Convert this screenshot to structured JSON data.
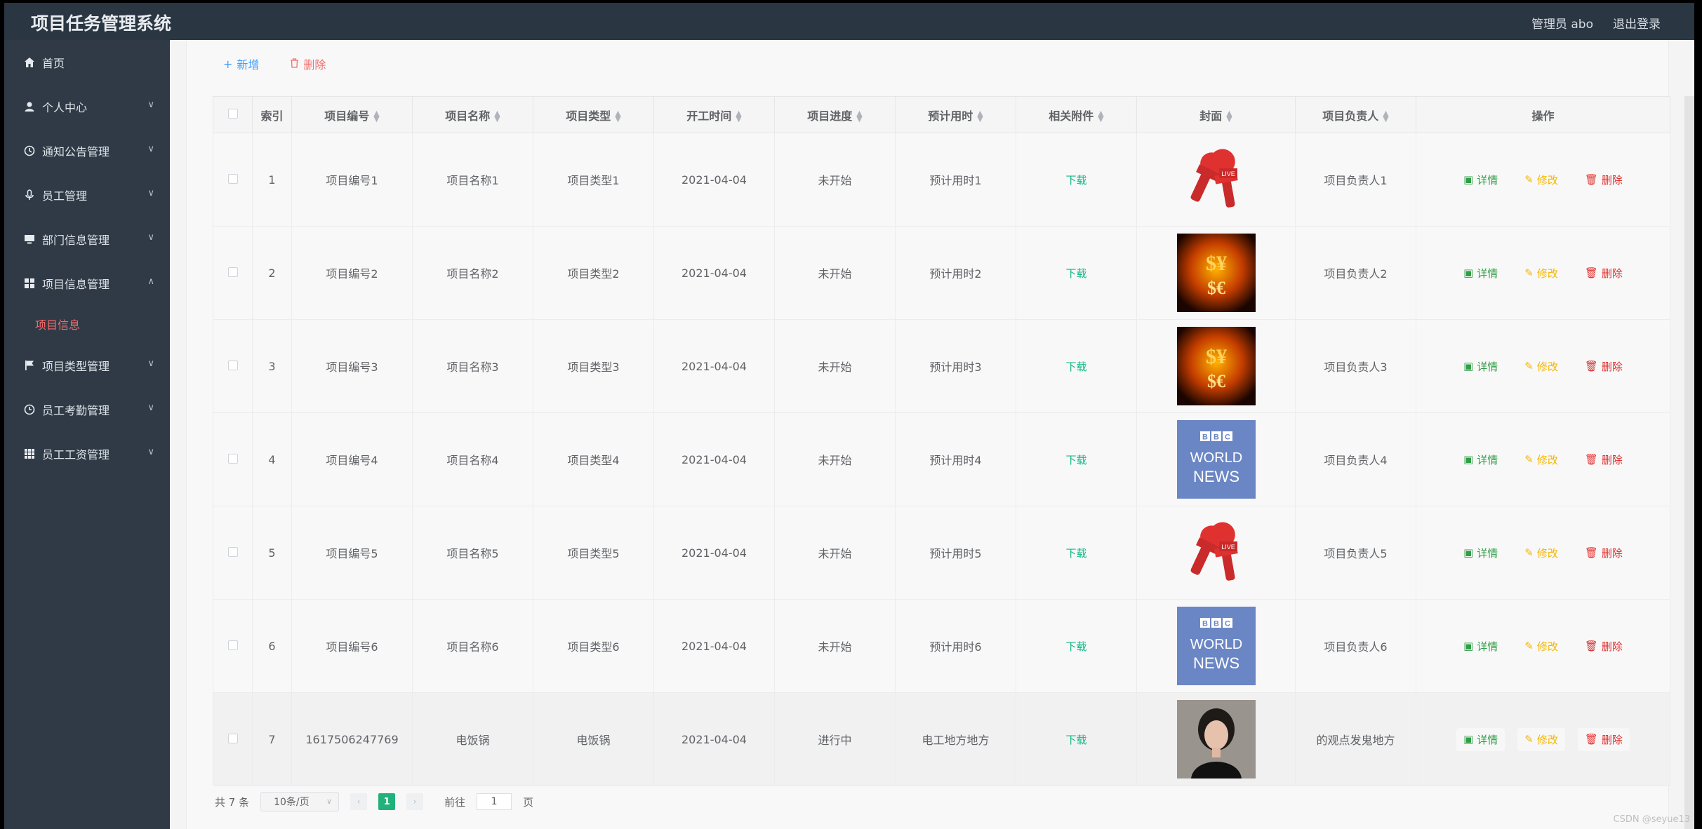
{
  "app": {
    "title": "项目任务管理系统",
    "user": "管理员 abo",
    "logout": "退出登录"
  },
  "sidebar": {
    "items": [
      {
        "label": "首页",
        "icon": "home-icon"
      },
      {
        "label": "个人中心",
        "icon": "user-icon"
      },
      {
        "label": "通知公告管理",
        "icon": "bell-icon"
      },
      {
        "label": "员工管理",
        "icon": "mic-icon"
      },
      {
        "label": "部门信息管理",
        "icon": "monitor-icon"
      },
      {
        "label": "项目信息管理",
        "icon": "grid-icon"
      },
      {
        "label": "项目类型管理",
        "icon": "flag-icon"
      },
      {
        "label": "员工考勤管理",
        "icon": "clock-icon"
      },
      {
        "label": "员工工资管理",
        "icon": "apps-icon"
      }
    ],
    "sub_item": "项目信息"
  },
  "toolbar": {
    "add": "新增",
    "delete": "删除"
  },
  "table": {
    "headers": [
      "索引",
      "项目编号",
      "项目名称",
      "项目类型",
      "开工时间",
      "项目进度",
      "预计用时",
      "相关附件",
      "封面",
      "项目负责人",
      "操作"
    ],
    "rows": [
      {
        "index": "1",
        "code": "项目编号1",
        "name": "项目名称1",
        "type": "项目类型1",
        "start": "2021-04-04",
        "progress": "未开始",
        "duration": "预计用时1",
        "attachment": "下载",
        "cover": "microphone-live",
        "owner": "项目负责人1"
      },
      {
        "index": "2",
        "code": "项目编号2",
        "name": "项目名称2",
        "type": "项目类型2",
        "start": "2021-04-04",
        "progress": "未开始",
        "duration": "预计用时2",
        "attachment": "下载",
        "cover": "money-fire",
        "owner": "项目负责人2"
      },
      {
        "index": "3",
        "code": "项目编号3",
        "name": "项目名称3",
        "type": "项目类型3",
        "start": "2021-04-04",
        "progress": "未开始",
        "duration": "预计用时3",
        "attachment": "下载",
        "cover": "money-fire",
        "owner": "项目负责人3"
      },
      {
        "index": "4",
        "code": "项目编号4",
        "name": "项目名称4",
        "type": "项目类型4",
        "start": "2021-04-04",
        "progress": "未开始",
        "duration": "预计用时4",
        "attachment": "下载",
        "cover": "bbc-news",
        "owner": "项目负责人4"
      },
      {
        "index": "5",
        "code": "项目编号5",
        "name": "项目名称5",
        "type": "项目类型5",
        "start": "2021-04-04",
        "progress": "未开始",
        "duration": "预计用时5",
        "attachment": "下载",
        "cover": "microphone-live",
        "owner": "项目负责人5"
      },
      {
        "index": "6",
        "code": "项目编号6",
        "name": "项目名称6",
        "type": "项目类型6",
        "start": "2021-04-04",
        "progress": "未开始",
        "duration": "预计用时6",
        "attachment": "下载",
        "cover": "bbc-news",
        "owner": "项目负责人6"
      },
      {
        "index": "7",
        "code": "1617506247769",
        "name": "电饭锅",
        "type": "电饭锅",
        "start": "2021-04-04",
        "progress": "进行中",
        "duration": "电工地方地方",
        "attachment": "下载",
        "cover": "portrait",
        "owner": "的观点发鬼地方"
      }
    ],
    "actions": {
      "detail": "详情",
      "edit": "修改",
      "delete": "删除"
    },
    "cover_texts": {
      "live": "LIVE",
      "bbc": "BBC",
      "world": "WORLD",
      "news": "NEWS"
    }
  },
  "pagination": {
    "total": "共 7 条",
    "page_size": "10条/页",
    "current_page": "1",
    "goto_prefix": "前往",
    "goto_value": "1",
    "goto_suffix": "页"
  },
  "watermark": "CSDN @seyue13",
  "colors": {
    "topbar": "#2b3643",
    "sidebar": "#2f3a46",
    "active": "#f56c6c",
    "download": "#12b886",
    "page_active": "#20b27a"
  }
}
